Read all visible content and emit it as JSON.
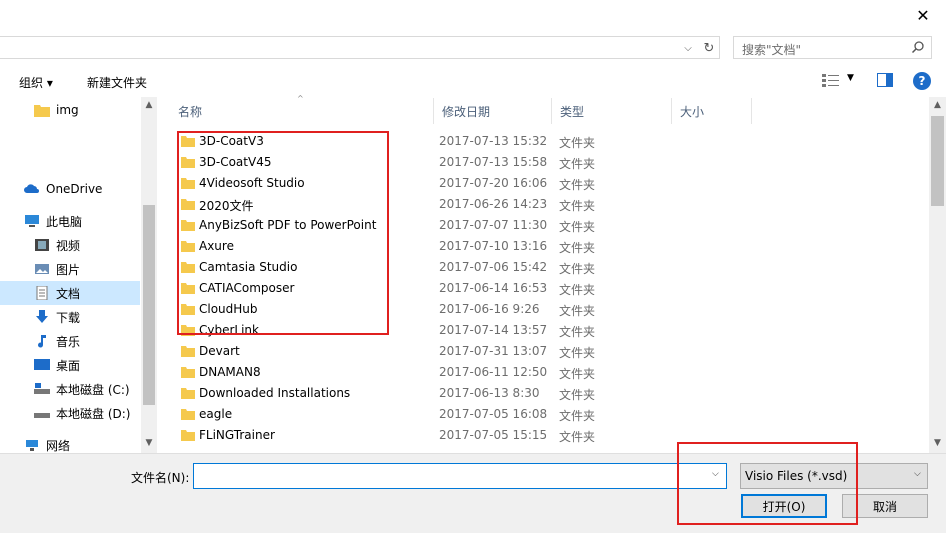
{
  "search": {
    "placeholder": "搜索\"文档\""
  },
  "toolbar": {
    "organize": "组织 ▾",
    "new_folder": "新建文件夹"
  },
  "nav": {
    "items": [
      {
        "label": "img",
        "icon": "folder-icon"
      },
      {
        "label": "OneDrive",
        "icon": "cloud-icon"
      },
      {
        "label": "此电脑",
        "icon": "computer-icon"
      },
      {
        "label": "视频",
        "icon": "video-icon"
      },
      {
        "label": "图片",
        "icon": "picture-icon"
      },
      {
        "label": "文档",
        "icon": "document-icon"
      },
      {
        "label": "下载",
        "icon": "download-icon"
      },
      {
        "label": "音乐",
        "icon": "music-icon"
      },
      {
        "label": "桌面",
        "icon": "desktop-icon"
      },
      {
        "label": "本地磁盘 (C:)",
        "icon": "drive-icon"
      },
      {
        "label": "本地磁盘 (D:)",
        "icon": "drive-icon"
      },
      {
        "label": "网络",
        "icon": "network-icon"
      }
    ]
  },
  "columns": {
    "name": "名称",
    "date": "修改日期",
    "type": "类型",
    "size": "大小"
  },
  "files": [
    {
      "name": "3D-CoatV3",
      "date": "2017-07-13 15:32",
      "type": "文件夹"
    },
    {
      "name": "3D-CoatV45",
      "date": "2017-07-13 15:58",
      "type": "文件夹"
    },
    {
      "name": "4Videosoft Studio",
      "date": "2017-07-20 16:06",
      "type": "文件夹"
    },
    {
      "name": "2020文件",
      "date": "2017-06-26 14:23",
      "type": "文件夹"
    },
    {
      "name": "AnyBizSoft PDF to PowerPoint",
      "date": "2017-07-07 11:30",
      "type": "文件夹"
    },
    {
      "name": "Axure",
      "date": "2017-07-10 13:16",
      "type": "文件夹"
    },
    {
      "name": "Camtasia Studio",
      "date": "2017-07-06 15:42",
      "type": "文件夹"
    },
    {
      "name": "CATIAComposer",
      "date": "2017-06-14 16:53",
      "type": "文件夹"
    },
    {
      "name": "CloudHub",
      "date": "2017-06-16 9:26",
      "type": "文件夹"
    },
    {
      "name": "CyberLink",
      "date": "2017-07-14 13:57",
      "type": "文件夹"
    },
    {
      "name": "Devart",
      "date": "2017-07-31 13:07",
      "type": "文件夹"
    },
    {
      "name": "DNAMAN8",
      "date": "2017-06-11 12:50",
      "type": "文件夹"
    },
    {
      "name": "Downloaded Installations",
      "date": "2017-06-13 8:30",
      "type": "文件夹"
    },
    {
      "name": "eagle",
      "date": "2017-07-05 16:08",
      "type": "文件夹"
    },
    {
      "name": "FLiNGTrainer",
      "date": "2017-07-05 15:15",
      "type": "文件夹"
    }
  ],
  "bottom": {
    "filename_label": "文件名(N):",
    "filename_value": "",
    "filter": "Visio Files (*.vsd)",
    "open_label": "打开(O)",
    "cancel_label": "取消"
  },
  "colors": {
    "highlight": "#e0201f",
    "selected": "#cce8ff",
    "folder": "#f5c94d",
    "accent": "#0078d7"
  }
}
